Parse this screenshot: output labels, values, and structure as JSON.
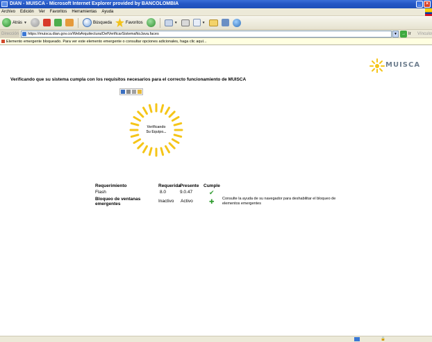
{
  "window": {
    "title": "DIAN - MUISCA - Microsoft Internet Explorer provided by BANCOLOMBIA"
  },
  "menu": [
    "Archivo",
    "Edición",
    "Ver",
    "Favoritos",
    "Herramientas",
    "Ayuda"
  ],
  "toolbar": {
    "back_label": "Atrás",
    "search_label": "Búsqueda",
    "favorites_label": "Favoritos"
  },
  "address": {
    "label": "Dirección",
    "url": "https://muisca.dian.gov.co/WebArquitectura/DefVerificarSistemaNoJava.faces",
    "go_label": "Ir",
    "links_label": "Vínculos"
  },
  "infobar": {
    "text": "Elemento emergente bloqueado.  Para ver este elemento emergente o consultar opciones adicionales, haga clic aquí..."
  },
  "logo": {
    "text": "MUISCA"
  },
  "page": {
    "heading": "Verificando que su sistema cumpla con los requisitos necesarios para el correcto funcionamiento de MUISCA",
    "spinner_line1": "Verificando",
    "spinner_line2": "Su Equipo..."
  },
  "requirements": {
    "headers": {
      "requirement": "Requerimiento",
      "required": "Requerida",
      "present": "Presente",
      "complies": "Cumple"
    },
    "rows": [
      {
        "name": "Flash",
        "required": "8.0",
        "present": "9.0.47",
        "complies": "check"
      },
      {
        "name": "Bloqueo de ventanas emergentes",
        "required": "Inactivo",
        "present": "Activo",
        "complies": "plus",
        "note": "Consulte la ayuda de su navegador para deshabilitar el bloqueo de elementos emergentes"
      }
    ]
  },
  "colors": {
    "titlebar": "#2457c5",
    "chrome": "#ece9d8",
    "spinner": "#f5c518",
    "ok": "#2e9b2e"
  }
}
